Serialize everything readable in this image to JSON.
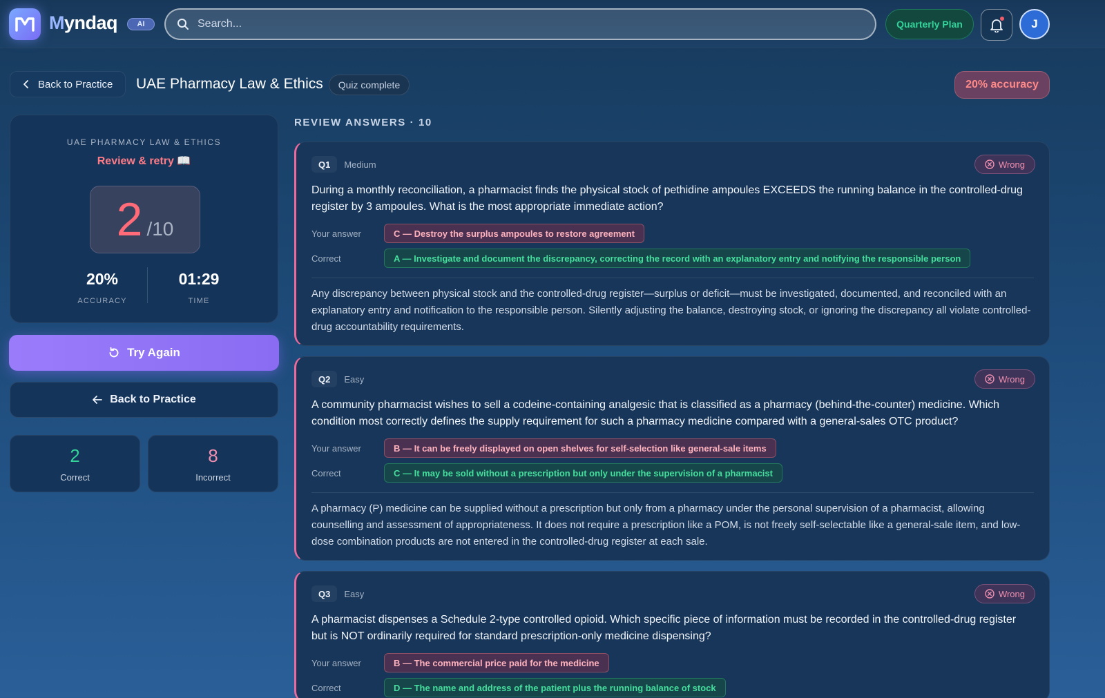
{
  "header": {
    "brand_first": "M",
    "brand_rest": "yndaq",
    "ai_badge": "AI",
    "search_placeholder": "Search...",
    "plan_label": "Quarterly Plan",
    "avatar_initial": "J"
  },
  "page": {
    "back_label": "Back to Practice",
    "title": "UAE Pharmacy Law & Ethics",
    "status": "Quiz complete",
    "accuracy_chip": "20% accuracy"
  },
  "summary": {
    "subject": "UAE PHARMACY LAW & ETHICS",
    "message": "Review & retry 📖",
    "score": "2",
    "total": "/10",
    "accuracy_value": "20%",
    "accuracy_label": "ACCURACY",
    "time_value": "01:29",
    "time_label": "TIME",
    "try_again_label": "Try Again",
    "back_label": "Back to Practice",
    "correct_count": "2",
    "correct_label": "Correct",
    "incorrect_count": "8",
    "incorrect_label": "Incorrect"
  },
  "review": {
    "title": "REVIEW ANSWERS · 10",
    "your_answer_label": "Your answer",
    "correct_label": "Correct",
    "wrong_label": "Wrong",
    "questions": [
      {
        "num": "Q1",
        "difficulty": "Medium",
        "text": "During a monthly reconciliation, a pharmacist finds the physical stock of pethidine ampoules EXCEEDS the running balance in the controlled-drug register by 3 ampoules. What is the most appropriate immediate action?",
        "your_answer": "C — Destroy the surplus ampoules to restore agreement",
        "correct_answer": "A — Investigate and document the discrepancy, correcting the record with an explanatory entry and notifying the responsible person",
        "explanation": "Any discrepancy between physical stock and the controlled-drug register—surplus or deficit—must be investigated, documented, and reconciled with an explanatory entry and notification to the responsible person. Silently adjusting the balance, destroying stock, or ignoring the discrepancy all violate controlled-drug accountability requirements."
      },
      {
        "num": "Q2",
        "difficulty": "Easy",
        "text": "A community pharmacist wishes to sell a codeine-containing analgesic that is classified as a pharmacy (behind-the-counter) medicine. Which condition most correctly defines the supply requirement for such a pharmacy medicine compared with a general-sales OTC product?",
        "your_answer": "B — It can be freely displayed on open shelves for self-selection like general-sale items",
        "correct_answer": "C — It may be sold without a prescription but only under the supervision of a pharmacist",
        "explanation": "A pharmacy (P) medicine can be supplied without a prescription but only from a pharmacy under the personal supervision of a pharmacist, allowing counselling and assessment of appropriateness. It does not require a prescription like a POM, is not freely self-selectable like a general-sale item, and low-dose combination products are not entered in the controlled-drug register at each sale."
      },
      {
        "num": "Q3",
        "difficulty": "Easy",
        "text": "A pharmacist dispenses a Schedule 2-type controlled opioid. Which specific piece of information must be recorded in the controlled-drug register but is NOT ordinarily required for standard prescription-only medicine dispensing?",
        "your_answer": "B — The commercial price paid for the medicine",
        "correct_answer": "D — The name and address of the patient plus the running balance of stock",
        "explanation": ""
      }
    ]
  },
  "colors": {
    "accent": "#8a6cf3",
    "wrong": "#ff6b78",
    "correct": "#34d399",
    "question_border": "#ec6a9c"
  }
}
